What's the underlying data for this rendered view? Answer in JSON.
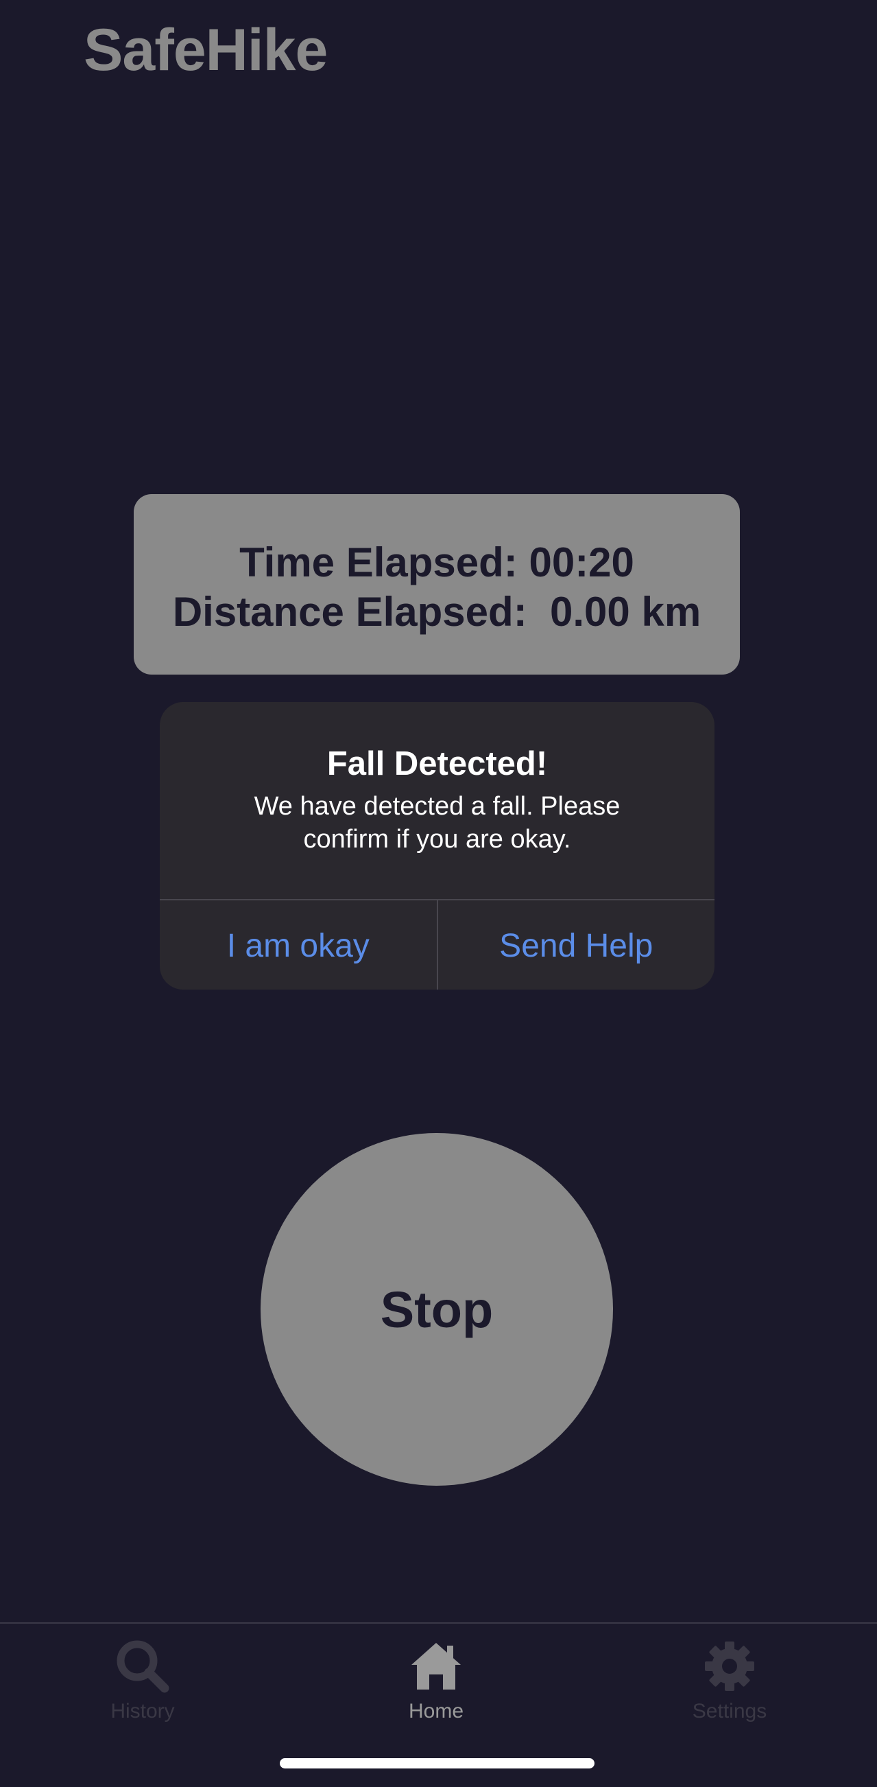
{
  "app": {
    "title": "SafeHike"
  },
  "stats": {
    "time_line": "Time Elapsed: 00:20",
    "distance_line": "Distance Elapsed:  0.00 km"
  },
  "alert": {
    "title": "Fall Detected!",
    "message": "We have detected a fall. Please confirm if you are okay.",
    "ok_label": "I am okay",
    "help_label": "Send Help"
  },
  "stop_button": {
    "label": "Stop"
  },
  "tab_bar": {
    "items": [
      {
        "label": "History",
        "icon": "search-icon",
        "active": false
      },
      {
        "label": "Home",
        "icon": "home-icon",
        "active": true
      },
      {
        "label": "Settings",
        "icon": "gear-icon",
        "active": false
      }
    ]
  },
  "colors": {
    "background": "#1b192b",
    "card": "#8a8a8a",
    "alert_background": "#2a282e",
    "accent_blue": "#5b8de8",
    "inactive_tab": "#3a3845",
    "active_tab": "#9a9a9a"
  }
}
